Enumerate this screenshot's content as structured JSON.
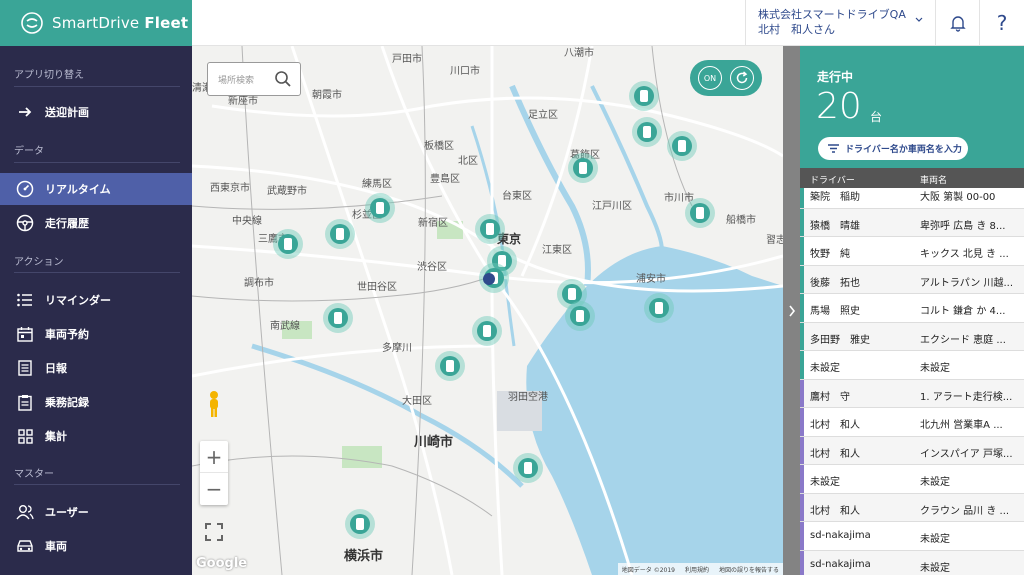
{
  "header": {
    "logo_text_regular": "SmartDrive",
    "logo_text_bold": "Fleet",
    "company": "株式会社スマートドライブQA",
    "user": "北村　和人さん",
    "help_symbol": "?"
  },
  "sidebar": {
    "sections": {
      "app_switch": "アプリ切り替え",
      "data": "データ",
      "action": "アクション",
      "master": "マスター"
    },
    "items": [
      {
        "label": "送迎計画",
        "icon": "arrow-right-icon"
      },
      {
        "label": "リアルタイム",
        "icon": "speedometer-icon"
      },
      {
        "label": "走行履歴",
        "icon": "steering-wheel-icon"
      },
      {
        "label": "リマインダー",
        "icon": "list-icon"
      },
      {
        "label": "車両予約",
        "icon": "calendar-icon"
      },
      {
        "label": "日報",
        "icon": "report-icon"
      },
      {
        "label": "乗務記録",
        "icon": "clipboard-icon"
      },
      {
        "label": "集計",
        "icon": "grid-icon"
      },
      {
        "label": "ユーザー",
        "icon": "users-icon"
      },
      {
        "label": "車両",
        "icon": "car-icon"
      }
    ]
  },
  "map": {
    "search_placeholder": "場所検索",
    "toggle_label": "ON",
    "google_label": "Google",
    "attribution": [
      "地図データ ©2019",
      "利用規約",
      "地図の誤りを報告する"
    ],
    "places": [
      {
        "name": "戸田市"
      },
      {
        "name": "川口市"
      },
      {
        "name": "八潮市"
      },
      {
        "name": "朝霞市"
      },
      {
        "name": "新座市"
      },
      {
        "name": "清瀬市"
      },
      {
        "name": "足立区"
      },
      {
        "name": "板橋区"
      },
      {
        "name": "北区"
      },
      {
        "name": "練馬区"
      },
      {
        "name": "豊島区"
      },
      {
        "name": "葛飾区"
      },
      {
        "name": "西東京市"
      },
      {
        "name": "武蔵野市"
      },
      {
        "name": "杉並区"
      },
      {
        "name": "新宿区"
      },
      {
        "name": "台東区"
      },
      {
        "name": "江戸川区"
      },
      {
        "name": "市川市"
      },
      {
        "name": "船橋市"
      },
      {
        "name": "中央線"
      },
      {
        "name": "三鷹市"
      },
      {
        "name": "東京"
      },
      {
        "name": "江東区"
      },
      {
        "name": "習志野"
      },
      {
        "name": "渋谷区"
      },
      {
        "name": "世田谷区"
      },
      {
        "name": "浦安市"
      },
      {
        "name": "調布市"
      },
      {
        "name": "南武線"
      },
      {
        "name": "多摩川"
      },
      {
        "name": "大田区"
      },
      {
        "name": "羽田空港"
      },
      {
        "name": "川崎市"
      },
      {
        "name": "横浜市"
      },
      {
        "name": "清瀬市"
      }
    ]
  },
  "panel": {
    "status_label": "走行中",
    "count": "20",
    "unit": "台",
    "filter_label": "ドライバー名か車両名を入力",
    "col_driver": "ドライバー",
    "col_vehicle": "車両名",
    "rows": [
      {
        "driver": "築院　稲助",
        "vehicle": "大阪 第製 00-00",
        "color": "#3aa597"
      },
      {
        "driver": "猿橋　晴雄",
        "vehicle": "卑弥呼 広島 き 8...",
        "color": "#3aa597"
      },
      {
        "driver": "牧野　純",
        "vehicle": "キックス 北見 き ...",
        "color": "#3aa597"
      },
      {
        "driver": "後藤　拓也",
        "vehicle": "アルトラパン 川越...",
        "color": "#3aa597"
      },
      {
        "driver": "馬場　照史",
        "vehicle": "コルト 鎌倉 か 4...",
        "color": "#3aa597"
      },
      {
        "driver": "多田野　雅史",
        "vehicle": "エクシード 恵庭 ...",
        "color": "#3aa597"
      },
      {
        "driver": "未設定",
        "vehicle": "未設定",
        "color": "#3aa597"
      },
      {
        "driver": "鷹村　守",
        "vehicle": "1. アラート走行検...",
        "color": "#8a79c9"
      },
      {
        "driver": "北村　和人",
        "vehicle": "北九州 営業車A ...",
        "color": "#8a79c9"
      },
      {
        "driver": "北村　和人",
        "vehicle": "インスパイア 戸塚...",
        "color": "#8a79c9"
      },
      {
        "driver": "未設定",
        "vehicle": "未設定",
        "color": "#8a79c9"
      },
      {
        "driver": "北村　和人",
        "vehicle": "クラウン 品川 き ...",
        "color": "#8a79c9"
      },
      {
        "driver": "sd-nakajima",
        "vehicle": "未設定",
        "color": "#8a79c9"
      },
      {
        "driver": "sd-nakajima",
        "vehicle": "未設定",
        "color": "#8a79c9"
      }
    ]
  },
  "colors": {
    "brand": "#3aa597",
    "sidebar_bg": "#2b2b4b",
    "active": "#4f60a8",
    "water": "#a6d4ea"
  }
}
